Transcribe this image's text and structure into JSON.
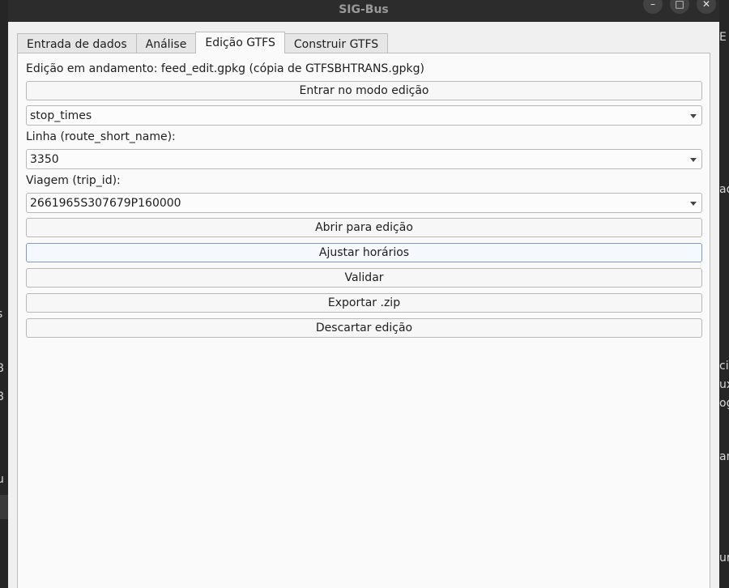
{
  "window": {
    "title": "SIG-Bus",
    "controls": {
      "minimize": "–",
      "maximize": "□",
      "close": "✕"
    }
  },
  "tabs": [
    {
      "label": "Entrada de dados",
      "active": false
    },
    {
      "label": "Análise",
      "active": false
    },
    {
      "label": "Edição GTFS",
      "active": true
    },
    {
      "label": "Construir GTFS",
      "active": false
    }
  ],
  "editor": {
    "status": "Edição em andamento: feed_edit.gpkg (cópia de GTFSBHTRANS.gpkg)",
    "enter_edit_mode": "Entrar no modo edição",
    "table_select": {
      "value": "stop_times"
    },
    "route_label": "Linha (route_short_name):",
    "route_select": {
      "value": "3350"
    },
    "trip_label": "Viagem (trip_id):",
    "trip_select": {
      "value": "2661965S307679P160000"
    },
    "actions": {
      "open_for_edit": "Abrir para edição",
      "adjust_times": "Ajustar horários",
      "validate": "Validar",
      "export_zip": "Exportar .zip",
      "discard": "Descartar edição"
    }
  },
  "background": {
    "left_fragments": [
      "s",
      "8",
      "8",
      "u"
    ],
    "right_fragments": [
      "E",
      "ad",
      "ci",
      "ux",
      "og",
      "an",
      "ur"
    ]
  },
  "colors": {
    "dialog_bg": "#f0f0f0",
    "panel_bg": "#fafafa",
    "titlebar_bg": "#2c2c2c",
    "focus_border": "#7a9cc6"
  }
}
